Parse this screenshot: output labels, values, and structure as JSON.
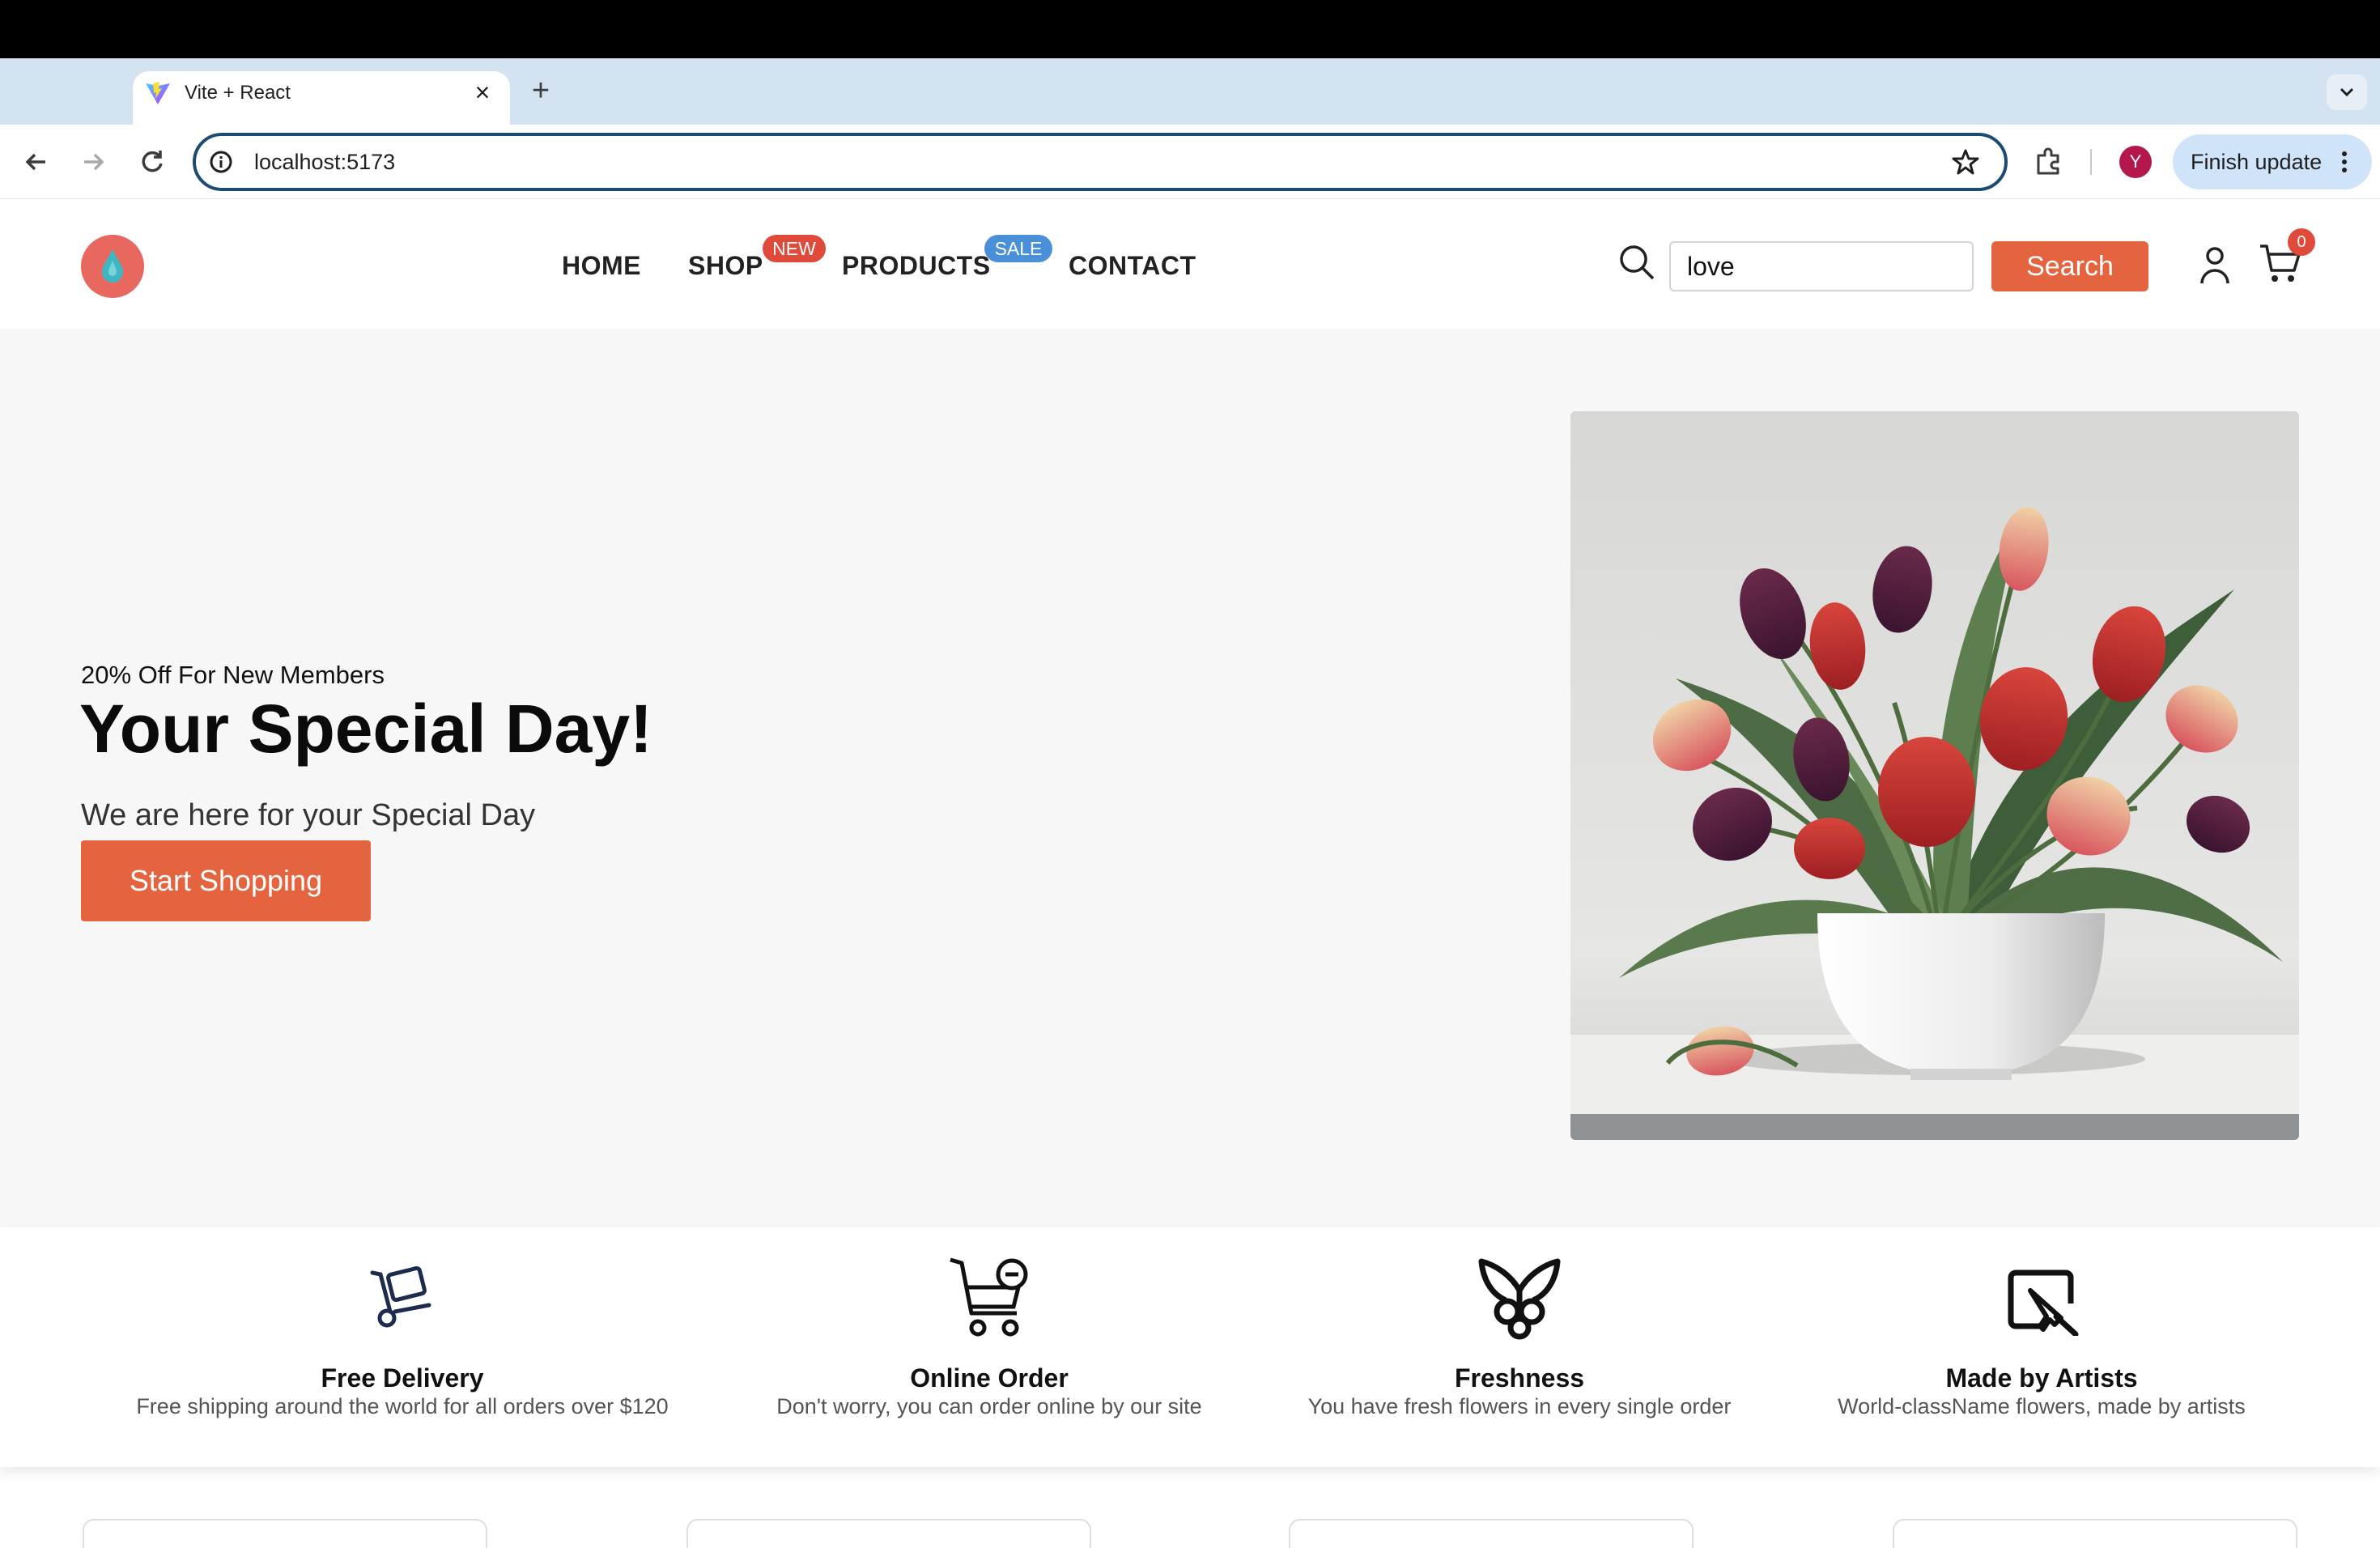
{
  "browser": {
    "tab_title": "Vite + React",
    "tab_close": "×",
    "new_tab": "+",
    "url": "localhost:5173",
    "profile_initial": "Y",
    "finish_update": "Finish update"
  },
  "header": {
    "nav": [
      {
        "label": "HOME"
      },
      {
        "label": "SHOP",
        "badge": "NEW"
      },
      {
        "label": "PRODUCTS",
        "badge": "SALE"
      },
      {
        "label": "CONTACT"
      }
    ],
    "search": {
      "value": "love",
      "button": "Search"
    },
    "cart_count": "0"
  },
  "hero": {
    "kicker": "20% Off For New Members",
    "title": "Your Special Day!",
    "subtitle": "We are here for your Special Day",
    "cta": "Start Shopping"
  },
  "features": [
    {
      "icon": "hand-truck-icon",
      "title": "Free Delivery",
      "desc": "Free shipping around the world for all orders over $120"
    },
    {
      "icon": "cart-minus-icon",
      "title": "Online Order",
      "desc": "Don't worry, you can order online by our site"
    },
    {
      "icon": "butterfly-icon",
      "title": "Freshness",
      "desc": "You have fresh flowers in every single order"
    },
    {
      "icon": "artist-brush-icon",
      "title": "Made by Artists",
      "desc": "World-className flowers, made by artists"
    }
  ],
  "colors": {
    "accent": "#e4643f",
    "badge_new": "#e04a3a",
    "badge_sale": "#4a90d9",
    "logo": "#e8685f"
  }
}
